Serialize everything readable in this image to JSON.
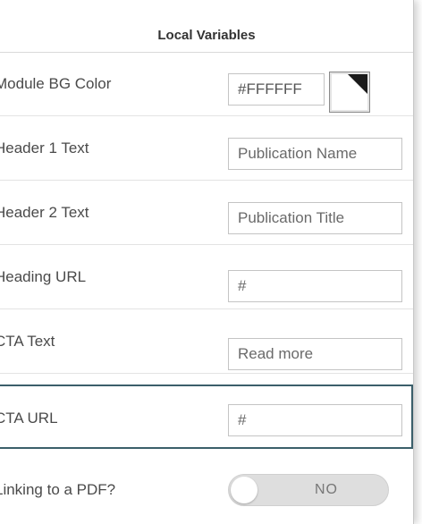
{
  "panel": {
    "title": "Local Variables"
  },
  "module_bg_color": {
    "label": "Module BG Color",
    "value": "#FFFFFF"
  },
  "header1_text": {
    "label": "Header 1 Text",
    "value": "Publication Name"
  },
  "header2_text": {
    "label": "Header 2 Text",
    "value": "Publication Title"
  },
  "heading_url": {
    "label": "Heading URL",
    "value": "#"
  },
  "cta_text": {
    "label": "CTA Text",
    "value": "Read more"
  },
  "cta_url": {
    "label": "CTA URL",
    "value": "#"
  },
  "linking_pdf": {
    "label": "Linking to a PDF?",
    "state": "NO"
  },
  "colors": {
    "focus_border": "#3b5f6a",
    "swatch": "#FFFFFF",
    "toggle_track": "#dedede"
  }
}
